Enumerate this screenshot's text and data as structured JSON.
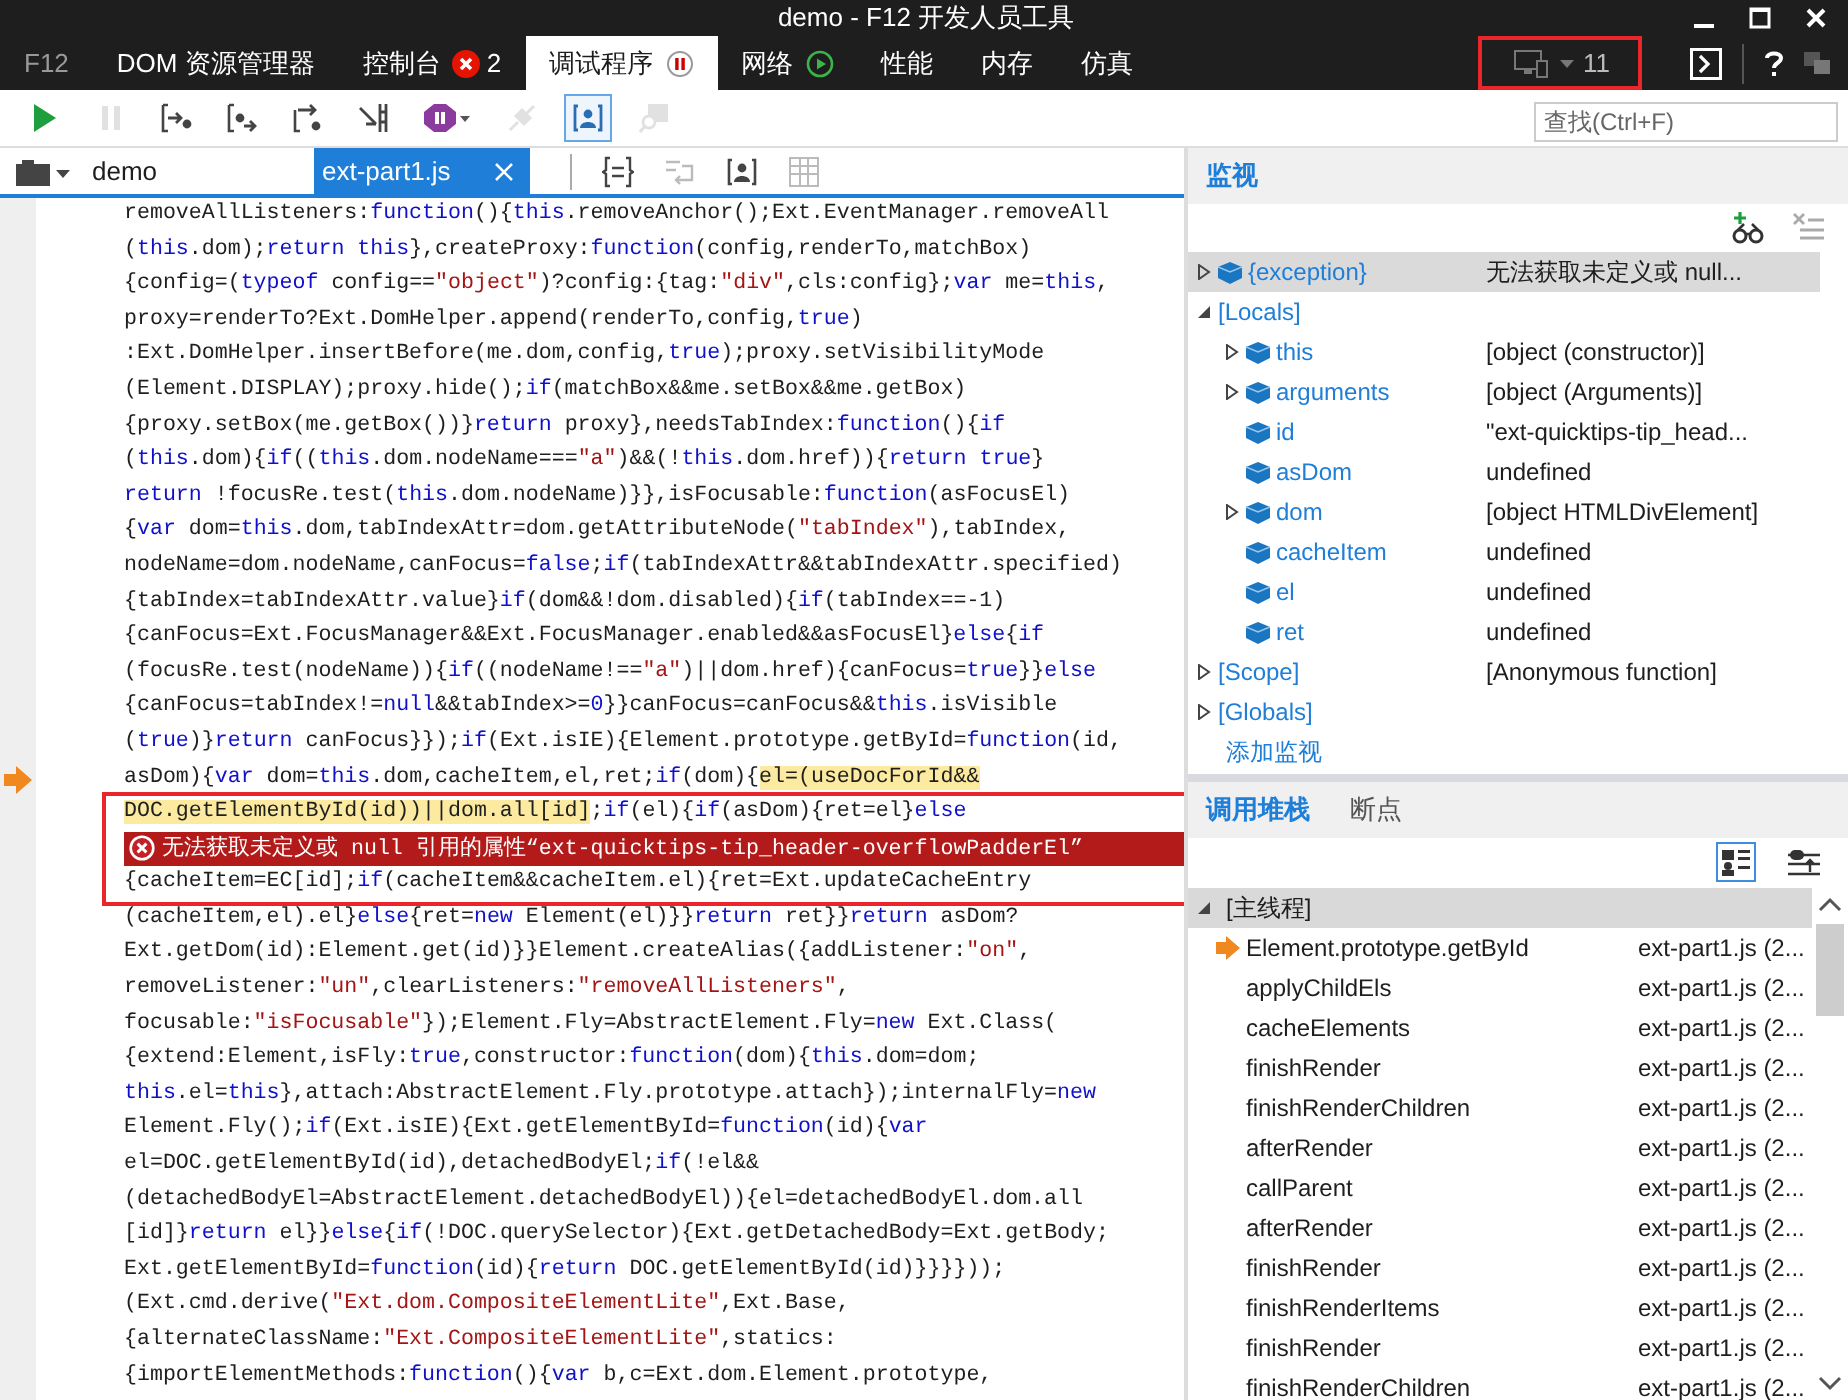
{
  "window": {
    "title": "demo - F12 开发人员工具"
  },
  "tabs": [
    {
      "label": "F12",
      "kind": "logo",
      "selected": false
    },
    {
      "label": "DOM 资源管理器",
      "kind": "plain",
      "selected": false
    },
    {
      "label": "控制台",
      "kind": "errors",
      "errors": "2",
      "selected": false
    },
    {
      "label": "调试程序",
      "kind": "paused",
      "selected": true
    },
    {
      "label": "网络",
      "kind": "running",
      "selected": false
    },
    {
      "label": "性能",
      "kind": "plain",
      "selected": false
    },
    {
      "label": "内存",
      "kind": "plain",
      "selected": false
    },
    {
      "label": "仿真",
      "kind": "plain",
      "selected": false
    }
  ],
  "target": {
    "label": "11",
    "framed": true
  },
  "toolbar": {
    "buttons": [
      {
        "kind": "continue",
        "disabled": false,
        "selected": false
      },
      {
        "kind": "pause",
        "disabled": true,
        "selected": false
      },
      {
        "kind": "step-into",
        "disabled": false,
        "selected": false
      },
      {
        "kind": "step-over",
        "disabled": false,
        "selected": false
      },
      {
        "kind": "step-out",
        "disabled": false,
        "selected": false
      },
      {
        "kind": "break-new-worker",
        "disabled": false,
        "selected": false
      },
      {
        "kind": "exceptions",
        "disabled": false,
        "selected": false
      },
      {
        "kind": "disconnect",
        "disabled": true,
        "selected": false
      },
      {
        "kind": "just-my-code",
        "disabled": false,
        "selected": true
      },
      {
        "kind": "find-source",
        "disabled": true,
        "selected": false
      }
    ],
    "search": {
      "placeholder": "查找(Ctrl+F)"
    }
  },
  "editor": {
    "file_tabs": [
      {
        "label": "demo",
        "selected": false
      },
      {
        "label": "ext-part1.js",
        "selected": true
      }
    ],
    "tools": [
      {
        "kind": "braces",
        "disabled": false
      },
      {
        "kind": "wrap",
        "disabled": true
      },
      {
        "kind": "person-braces",
        "disabled": false
      },
      {
        "kind": "map",
        "disabled": true
      }
    ],
    "lines": [
      {
        "kind": "code",
        "current": false,
        "framed": false,
        "segments": [
          {
            "kind": "plain",
            "text": "removeAllListeners:"
          },
          {
            "kind": "keyword",
            "text": "function"
          },
          {
            "kind": "plain",
            "text": "(){"
          },
          {
            "kind": "keyword",
            "text": "this"
          },
          {
            "kind": "plain",
            "text": ".removeAnchor();Ext.EventManager.removeAll"
          }
        ]
      },
      {
        "kind": "code",
        "current": false,
        "framed": false,
        "segments": [
          {
            "kind": "plain",
            "text": "("
          },
          {
            "kind": "keyword",
            "text": "this"
          },
          {
            "kind": "plain",
            "text": ".dom);"
          },
          {
            "kind": "keyword",
            "text": "return this"
          },
          {
            "kind": "plain",
            "text": "},createProxy:"
          },
          {
            "kind": "keyword",
            "text": "function"
          },
          {
            "kind": "plain",
            "text": "(config,renderTo,matchBox)"
          }
        ]
      },
      {
        "kind": "code",
        "current": false,
        "framed": false,
        "segments": [
          {
            "kind": "plain",
            "text": "{config=("
          },
          {
            "kind": "keyword",
            "text": "typeof"
          },
          {
            "kind": "plain",
            "text": " config=="
          },
          {
            "kind": "string",
            "text": "\"object\""
          },
          {
            "kind": "plain",
            "text": ")?config:{tag:"
          },
          {
            "kind": "string",
            "text": "\"div\""
          },
          {
            "kind": "plain",
            "text": ",cls:config};"
          },
          {
            "kind": "keyword",
            "text": "var"
          },
          {
            "kind": "plain",
            "text": " me="
          },
          {
            "kind": "keyword",
            "text": "this"
          },
          {
            "kind": "plain",
            "text": ","
          }
        ]
      },
      {
        "kind": "code",
        "current": false,
        "framed": false,
        "segments": [
          {
            "kind": "plain",
            "text": "proxy=renderTo?Ext.DomHelper.append(renderTo,config,"
          },
          {
            "kind": "keyword",
            "text": "true"
          },
          {
            "kind": "plain",
            "text": ")"
          }
        ]
      },
      {
        "kind": "code",
        "current": false,
        "framed": false,
        "segments": [
          {
            "kind": "plain",
            "text": ":Ext.DomHelper.insertBefore(me.dom,config,"
          },
          {
            "kind": "keyword",
            "text": "true"
          },
          {
            "kind": "plain",
            "text": ");proxy.setVisibilityMode"
          }
        ]
      },
      {
        "kind": "code",
        "current": false,
        "framed": false,
        "segments": [
          {
            "kind": "plain",
            "text": "(Element.DISPLAY);proxy.hide();"
          },
          {
            "kind": "keyword",
            "text": "if"
          },
          {
            "kind": "plain",
            "text": "(matchBox&&me.setBox&&me.getBox)"
          }
        ]
      },
      {
        "kind": "code",
        "current": false,
        "framed": false,
        "segments": [
          {
            "kind": "plain",
            "text": "{proxy.setBox(me.getBox())}"
          },
          {
            "kind": "keyword",
            "text": "return"
          },
          {
            "kind": "plain",
            "text": " proxy},needsTabIndex:"
          },
          {
            "kind": "keyword",
            "text": "function"
          },
          {
            "kind": "plain",
            "text": "(){"
          },
          {
            "kind": "keyword",
            "text": "if"
          }
        ]
      },
      {
        "kind": "code",
        "current": false,
        "framed": false,
        "segments": [
          {
            "kind": "plain",
            "text": "("
          },
          {
            "kind": "keyword",
            "text": "this"
          },
          {
            "kind": "plain",
            "text": ".dom){"
          },
          {
            "kind": "keyword",
            "text": "if"
          },
          {
            "kind": "plain",
            "text": "(("
          },
          {
            "kind": "keyword",
            "text": "this"
          },
          {
            "kind": "plain",
            "text": ".dom.nodeName==="
          },
          {
            "kind": "string",
            "text": "\"a\""
          },
          {
            "kind": "plain",
            "text": ")&&(!"
          },
          {
            "kind": "keyword",
            "text": "this"
          },
          {
            "kind": "plain",
            "text": ".dom.href)){"
          },
          {
            "kind": "keyword",
            "text": "return true"
          },
          {
            "kind": "plain",
            "text": "}"
          }
        ]
      },
      {
        "kind": "code",
        "current": false,
        "framed": false,
        "segments": [
          {
            "kind": "keyword",
            "text": "return"
          },
          {
            "kind": "plain",
            "text": " !focusRe.test("
          },
          {
            "kind": "keyword",
            "text": "this"
          },
          {
            "kind": "plain",
            "text": ".dom.nodeName)}},isFocusable:"
          },
          {
            "kind": "keyword",
            "text": "function"
          },
          {
            "kind": "plain",
            "text": "(asFocusEl)"
          }
        ]
      },
      {
        "kind": "code",
        "current": false,
        "framed": false,
        "segments": [
          {
            "kind": "plain",
            "text": "{"
          },
          {
            "kind": "keyword",
            "text": "var"
          },
          {
            "kind": "plain",
            "text": " dom="
          },
          {
            "kind": "keyword",
            "text": "this"
          },
          {
            "kind": "plain",
            "text": ".dom,tabIndexAttr=dom.getAttributeNode("
          },
          {
            "kind": "string",
            "text": "\"tabIndex\""
          },
          {
            "kind": "plain",
            "text": "),tabIndex,"
          }
        ]
      },
      {
        "kind": "code",
        "current": false,
        "framed": false,
        "segments": [
          {
            "kind": "plain",
            "text": "nodeName=dom.nodeName,canFocus="
          },
          {
            "kind": "keyword",
            "text": "false"
          },
          {
            "kind": "plain",
            "text": ";"
          },
          {
            "kind": "keyword",
            "text": "if"
          },
          {
            "kind": "plain",
            "text": "(tabIndexAttr&&tabIndexAttr.specified)"
          }
        ]
      },
      {
        "kind": "code",
        "current": false,
        "framed": false,
        "segments": [
          {
            "kind": "plain",
            "text": "{tabIndex=tabIndexAttr.value}"
          },
          {
            "kind": "keyword",
            "text": "if"
          },
          {
            "kind": "plain",
            "text": "(dom&&!dom.disabled){"
          },
          {
            "kind": "keyword",
            "text": "if"
          },
          {
            "kind": "plain",
            "text": "(tabIndex==-1)"
          }
        ]
      },
      {
        "kind": "code",
        "current": false,
        "framed": false,
        "segments": [
          {
            "kind": "plain",
            "text": "{canFocus=Ext.FocusManager&&Ext.FocusManager.enabled&&asFocusEl}"
          },
          {
            "kind": "keyword",
            "text": "else"
          },
          {
            "kind": "plain",
            "text": "{"
          },
          {
            "kind": "keyword",
            "text": "if"
          }
        ]
      },
      {
        "kind": "code",
        "current": false,
        "framed": false,
        "segments": [
          {
            "kind": "plain",
            "text": "(focusRe.test(nodeName)){"
          },
          {
            "kind": "keyword",
            "text": "if"
          },
          {
            "kind": "plain",
            "text": "((nodeName!=="
          },
          {
            "kind": "string",
            "text": "\"a\""
          },
          {
            "kind": "plain",
            "text": ")||dom.href){canFocus="
          },
          {
            "kind": "keyword",
            "text": "true"
          },
          {
            "kind": "plain",
            "text": "}}"
          },
          {
            "kind": "keyword",
            "text": "else"
          }
        ]
      },
      {
        "kind": "code",
        "current": false,
        "framed": false,
        "segments": [
          {
            "kind": "plain",
            "text": "{canFocus=tabIndex!="
          },
          {
            "kind": "keyword",
            "text": "null"
          },
          {
            "kind": "plain",
            "text": "&&tabIndex>="
          },
          {
            "kind": "keyword",
            "text": "0"
          },
          {
            "kind": "plain",
            "text": "}}canFocus=canFocus&&"
          },
          {
            "kind": "keyword",
            "text": "this"
          },
          {
            "kind": "plain",
            "text": ".isVisible"
          }
        ]
      },
      {
        "kind": "code",
        "current": false,
        "framed": false,
        "segments": [
          {
            "kind": "plain",
            "text": "("
          },
          {
            "kind": "keyword",
            "text": "true"
          },
          {
            "kind": "plain",
            "text": ")}"
          },
          {
            "kind": "keyword",
            "text": "return"
          },
          {
            "kind": "plain",
            "text": " canFocus}});"
          },
          {
            "kind": "keyword",
            "text": "if"
          },
          {
            "kind": "plain",
            "text": "(Ext.isIE){Element.prototype.getById="
          },
          {
            "kind": "keyword",
            "text": "function"
          },
          {
            "kind": "plain",
            "text": "(id,"
          }
        ]
      },
      {
        "kind": "code",
        "current": true,
        "framed": false,
        "segments": [
          {
            "kind": "plain",
            "text": "asDom){"
          },
          {
            "kind": "keyword",
            "text": "var"
          },
          {
            "kind": "plain",
            "text": " dom="
          },
          {
            "kind": "keyword",
            "text": "this"
          },
          {
            "kind": "plain",
            "text": ".dom,cacheItem,el,ret;"
          },
          {
            "kind": "keyword",
            "text": "if"
          },
          {
            "kind": "plain",
            "text": "(dom){"
          },
          {
            "kind": "highlight",
            "text": "el=(useDocForId&&"
          }
        ]
      },
      {
        "kind": "code",
        "current": false,
        "framed": true,
        "segments": [
          {
            "kind": "highlight",
            "text": "DOC.getElementById(id))||dom.all[id]"
          },
          {
            "kind": "plain",
            "text": ";"
          },
          {
            "kind": "keyword",
            "text": "if"
          },
          {
            "kind": "plain",
            "text": "(el){"
          },
          {
            "kind": "keyword",
            "text": "if"
          },
          {
            "kind": "plain",
            "text": "(asDom){ret=el}"
          },
          {
            "kind": "keyword",
            "text": "else"
          }
        ]
      },
      {
        "kind": "error",
        "framed": true,
        "text": "无法获取未定义或 null 引用的属性“ext-quicktips-tip_header-overflowPadderEl”"
      },
      {
        "kind": "code",
        "current": false,
        "framed": true,
        "segments": [
          {
            "kind": "plain",
            "text": "{cacheItem=EC[id];"
          },
          {
            "kind": "keyword",
            "text": "if"
          },
          {
            "kind": "plain",
            "text": "(cacheItem&&cacheItem.el){ret=Ext.updateCacheEntry"
          }
        ]
      },
      {
        "kind": "code",
        "current": false,
        "framed": false,
        "segments": [
          {
            "kind": "plain",
            "text": "(cacheItem,el).el}"
          },
          {
            "kind": "keyword",
            "text": "else"
          },
          {
            "kind": "plain",
            "text": "{ret="
          },
          {
            "kind": "keyword",
            "text": "new"
          },
          {
            "kind": "plain",
            "text": " Element(el)}}"
          },
          {
            "kind": "keyword",
            "text": "return"
          },
          {
            "kind": "plain",
            "text": " ret}}"
          },
          {
            "kind": "keyword",
            "text": "return"
          },
          {
            "kind": "plain",
            "text": " asDom?"
          }
        ]
      },
      {
        "kind": "code",
        "current": false,
        "framed": false,
        "segments": [
          {
            "kind": "plain",
            "text": "Ext.getDom(id):Element.get(id)}}Element.createAlias({addListener:"
          },
          {
            "kind": "string",
            "text": "\"on\""
          },
          {
            "kind": "plain",
            "text": ","
          }
        ]
      },
      {
        "kind": "code",
        "current": false,
        "framed": false,
        "segments": [
          {
            "kind": "plain",
            "text": "removeListener:"
          },
          {
            "kind": "string",
            "text": "\"un\""
          },
          {
            "kind": "plain",
            "text": ",clearListeners:"
          },
          {
            "kind": "string",
            "text": "\"removeAllListeners\""
          },
          {
            "kind": "plain",
            "text": ","
          }
        ]
      },
      {
        "kind": "code",
        "current": false,
        "framed": false,
        "segments": [
          {
            "kind": "plain",
            "text": "focusable:"
          },
          {
            "kind": "string",
            "text": "\"isFocusable\""
          },
          {
            "kind": "plain",
            "text": "});Element.Fly=AbstractElement.Fly="
          },
          {
            "kind": "keyword",
            "text": "new"
          },
          {
            "kind": "plain",
            "text": " Ext.Class("
          }
        ]
      },
      {
        "kind": "code",
        "current": false,
        "framed": false,
        "segments": [
          {
            "kind": "plain",
            "text": "{extend:Element,isFly:"
          },
          {
            "kind": "keyword",
            "text": "true"
          },
          {
            "kind": "plain",
            "text": ",constructor:"
          },
          {
            "kind": "keyword",
            "text": "function"
          },
          {
            "kind": "plain",
            "text": "(dom){"
          },
          {
            "kind": "keyword",
            "text": "this"
          },
          {
            "kind": "plain",
            "text": ".dom=dom;"
          }
        ]
      },
      {
        "kind": "code",
        "current": false,
        "framed": false,
        "segments": [
          {
            "kind": "keyword",
            "text": "this"
          },
          {
            "kind": "plain",
            "text": ".el="
          },
          {
            "kind": "keyword",
            "text": "this"
          },
          {
            "kind": "plain",
            "text": "},attach:AbstractElement.Fly.prototype.attach});internalFly="
          },
          {
            "kind": "keyword",
            "text": "new"
          }
        ]
      },
      {
        "kind": "code",
        "current": false,
        "framed": false,
        "segments": [
          {
            "kind": "plain",
            "text": "Element.Fly();"
          },
          {
            "kind": "keyword",
            "text": "if"
          },
          {
            "kind": "plain",
            "text": "(Ext.isIE){Ext.getElementById="
          },
          {
            "kind": "keyword",
            "text": "function"
          },
          {
            "kind": "plain",
            "text": "(id){"
          },
          {
            "kind": "keyword",
            "text": "var"
          }
        ]
      },
      {
        "kind": "code",
        "current": false,
        "framed": false,
        "segments": [
          {
            "kind": "plain",
            "text": "el=DOC.getElementById(id),detachedBodyEl;"
          },
          {
            "kind": "keyword",
            "text": "if"
          },
          {
            "kind": "plain",
            "text": "(!el&&"
          }
        ]
      },
      {
        "kind": "code",
        "current": false,
        "framed": false,
        "segments": [
          {
            "kind": "plain",
            "text": "(detachedBodyEl=AbstractElement.detachedBodyEl)){el=detachedBodyEl.dom.all"
          }
        ]
      },
      {
        "kind": "code",
        "current": false,
        "framed": false,
        "segments": [
          {
            "kind": "plain",
            "text": "[id]}"
          },
          {
            "kind": "keyword",
            "text": "return"
          },
          {
            "kind": "plain",
            "text": " el}}"
          },
          {
            "kind": "keyword",
            "text": "else"
          },
          {
            "kind": "plain",
            "text": "{"
          },
          {
            "kind": "keyword",
            "text": "if"
          },
          {
            "kind": "plain",
            "text": "(!DOC.querySelector){Ext.getDetachedBody=Ext.getBody;"
          }
        ]
      },
      {
        "kind": "code",
        "current": false,
        "framed": false,
        "segments": [
          {
            "kind": "plain",
            "text": "Ext.getElementById="
          },
          {
            "kind": "keyword",
            "text": "function"
          },
          {
            "kind": "plain",
            "text": "(id){"
          },
          {
            "kind": "keyword",
            "text": "return"
          },
          {
            "kind": "plain",
            "text": " DOC.getElementById(id)}}}}));"
          }
        ]
      },
      {
        "kind": "code",
        "current": false,
        "framed": false,
        "segments": [
          {
            "kind": "plain",
            "text": "(Ext.cmd.derive("
          },
          {
            "kind": "string",
            "text": "\"Ext.dom.CompositeElementLite\""
          },
          {
            "kind": "plain",
            "text": ",Ext.Base,"
          }
        ]
      },
      {
        "kind": "code",
        "current": false,
        "framed": false,
        "segments": [
          {
            "kind": "plain",
            "text": "{alternateClassName:"
          },
          {
            "kind": "string",
            "text": "\"Ext.CompositeElementLite\""
          },
          {
            "kind": "plain",
            "text": ",statics:"
          }
        ]
      },
      {
        "kind": "code",
        "current": false,
        "framed": false,
        "segments": [
          {
            "kind": "plain",
            "text": "{importElementMethods:"
          },
          {
            "kind": "keyword",
            "text": "function"
          },
          {
            "kind": "plain",
            "text": "(){"
          },
          {
            "kind": "keyword",
            "text": "var"
          },
          {
            "kind": "plain",
            "text": " b,c=Ext.dom.Element.prototype,"
          }
        ]
      }
    ]
  },
  "watch": {
    "title": "监视",
    "tools": [
      {
        "kind": "add-watch",
        "disabled": false
      },
      {
        "kind": "delete-all",
        "disabled": true
      }
    ],
    "items": [
      {
        "kind": "variable",
        "name": "{exception}",
        "value": "无法获取未定义或 null...",
        "expanded": false,
        "selected": true
      },
      {
        "kind": "group",
        "name": "[Locals]",
        "expanded": true,
        "selected": false,
        "children": [
          {
            "kind": "variable",
            "name": "this",
            "value": "[object (constructor)]",
            "expanded": false,
            "selected": false
          },
          {
            "kind": "variable",
            "name": "arguments",
            "value": "[object (Arguments)]",
            "expanded": false,
            "selected": false
          },
          {
            "kind": "variable",
            "name": "id",
            "value": "\"ext-quicktips-tip_head...",
            "selected": false
          },
          {
            "kind": "variable",
            "name": "asDom",
            "value": "undefined",
            "selected": false
          },
          {
            "kind": "variable",
            "name": "dom",
            "value": "[object HTMLDivElement]",
            "expanded": false,
            "selected": false
          },
          {
            "kind": "variable",
            "name": "cacheItem",
            "value": "undefined",
            "selected": false
          },
          {
            "kind": "variable",
            "name": "el",
            "value": "undefined",
            "selected": false
          },
          {
            "kind": "variable",
            "name": "ret",
            "value": "undefined",
            "selected": false
          }
        ]
      },
      {
        "kind": "group",
        "name": "[Scope]",
        "value": "[Anonymous function]",
        "expanded": false,
        "selected": false
      },
      {
        "kind": "group",
        "name": "[Globals]",
        "expanded": false,
        "selected": false
      }
    ],
    "add_link": "添加监视"
  },
  "call_stack": {
    "tabs": [
      {
        "label": "调用堆栈",
        "selected": true
      },
      {
        "label": "断点",
        "selected": false
      }
    ],
    "tools": [
      {
        "kind": "show-frames",
        "selected": true
      },
      {
        "kind": "step-to-top",
        "selected": false
      }
    ],
    "thread": {
      "label": "[主线程]",
      "expanded": true
    },
    "frames": [
      {
        "name": "Element.prototype.getById",
        "location": "ext-part1.js (2...",
        "current": true
      },
      {
        "name": "applyChildEls",
        "location": "ext-part1.js (2...",
        "current": false
      },
      {
        "name": "cacheElements",
        "location": "ext-part1.js (2...",
        "current": false
      },
      {
        "name": "finishRender",
        "location": "ext-part1.js (2...",
        "current": false
      },
      {
        "name": "finishRenderChildren",
        "location": "ext-part1.js (2...",
        "current": false
      },
      {
        "name": "afterRender",
        "location": "ext-part1.js (2...",
        "current": false
      },
      {
        "name": "callParent",
        "location": "ext-part1.js (2...",
        "current": false
      },
      {
        "name": "afterRender",
        "location": "ext-part1.js (2...",
        "current": false
      },
      {
        "name": "finishRender",
        "location": "ext-part1.js (2...",
        "current": false
      },
      {
        "name": "finishRenderItems",
        "location": "ext-part1.js (2...",
        "current": false
      },
      {
        "name": "finishRender",
        "location": "ext-part1.js (2...",
        "current": false
      },
      {
        "name": "finishRenderChildren",
        "location": "ext-part1.js (2...",
        "current": false
      }
    ]
  }
}
